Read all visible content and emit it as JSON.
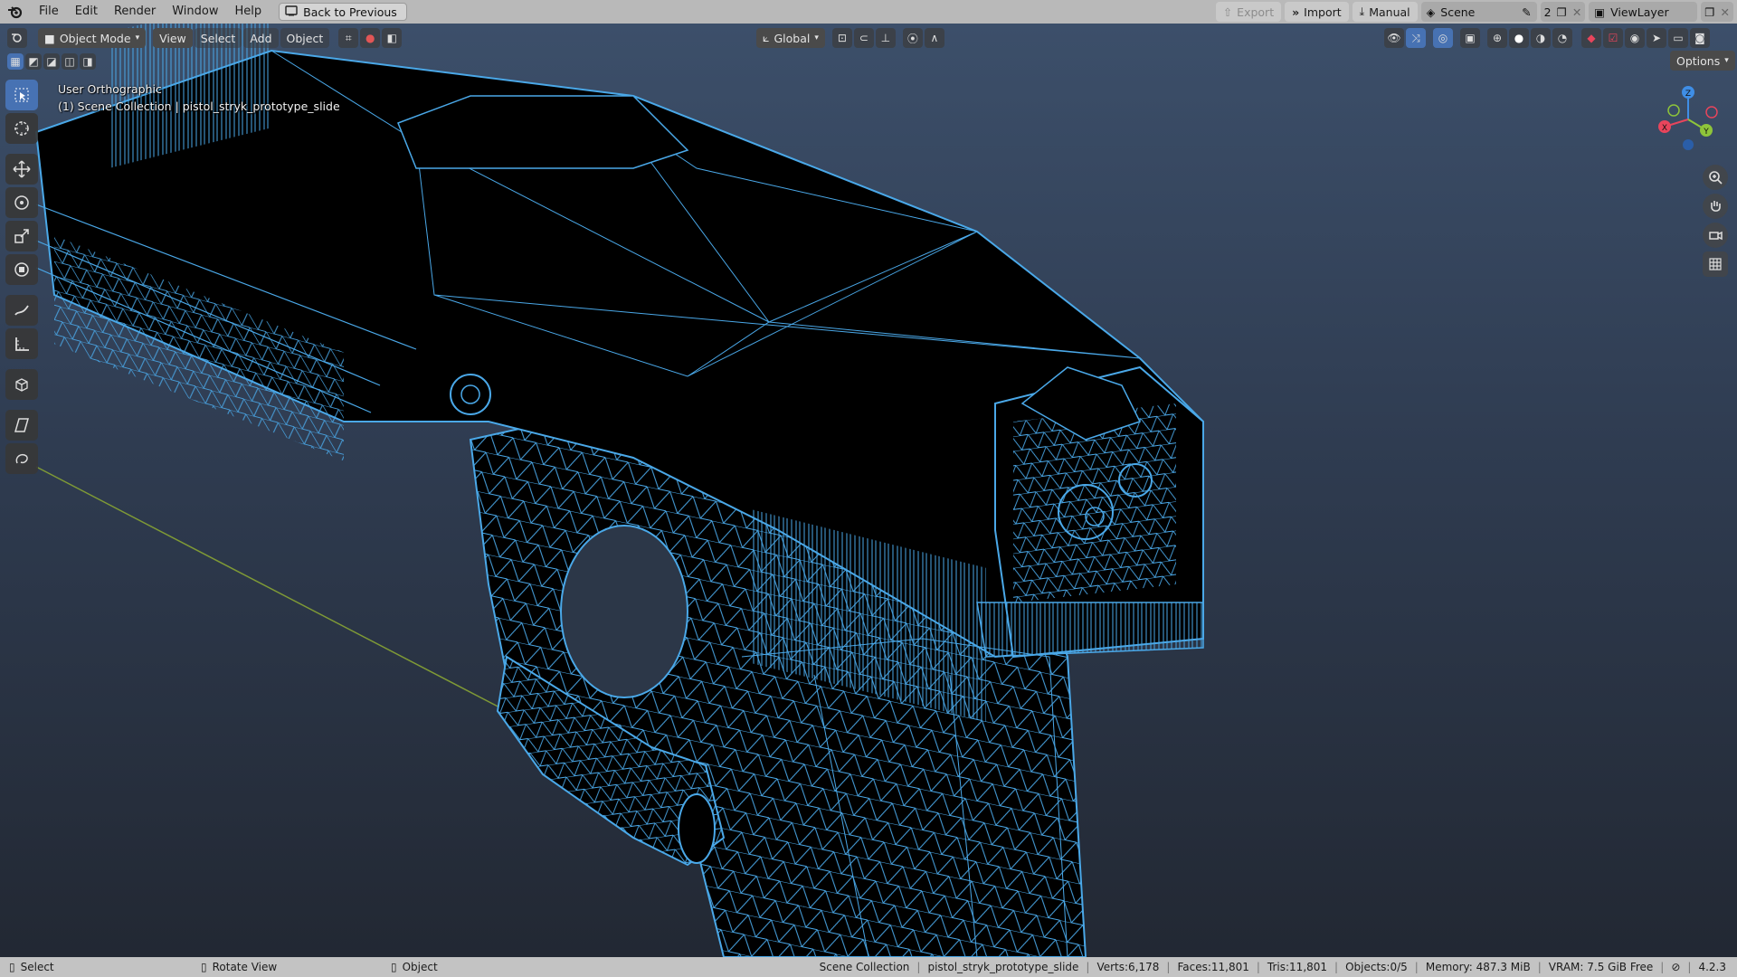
{
  "menu": {
    "items": [
      "File",
      "Edit",
      "Render",
      "Window",
      "Help"
    ],
    "back_button": "Back to Previous"
  },
  "topbar_right": {
    "export": "Export",
    "import": "Import",
    "manual": "Manual",
    "scene": "Scene",
    "scene_count": "2",
    "view_layer": "ViewLayer"
  },
  "viewport_header": {
    "mode": "Object Mode",
    "view": "View",
    "select": "Select",
    "add": "Add",
    "object": "Object",
    "transform_orientation": "Global",
    "options": "Options"
  },
  "overlay": {
    "view_name": "User Orthographic",
    "collection_info": "(1) Scene Collection | pistol_stryk_prototype_slide"
  },
  "gizmo": {
    "x": "X",
    "y": "Y",
    "z": "Z"
  },
  "status": {
    "select": "Select",
    "rotate": "Rotate View",
    "object": "Object",
    "collection": "Scene Collection",
    "object_name": "pistol_stryk_prototype_slide",
    "verts": "Verts:6,178",
    "faces": "Faces:11,801",
    "tris": "Tris:11,801",
    "objects": "Objects:0/5",
    "memory": "Memory: 487.3 MiB",
    "vram": "VRAM: 7.5 GiB Free",
    "version": "4.2.3"
  },
  "colors": {
    "wire": "#4aa8e8",
    "x_axis": "#e8455c",
    "y_axis": "#8ec43a",
    "z_axis": "#3f8ee6",
    "accent": "#4772b3"
  }
}
